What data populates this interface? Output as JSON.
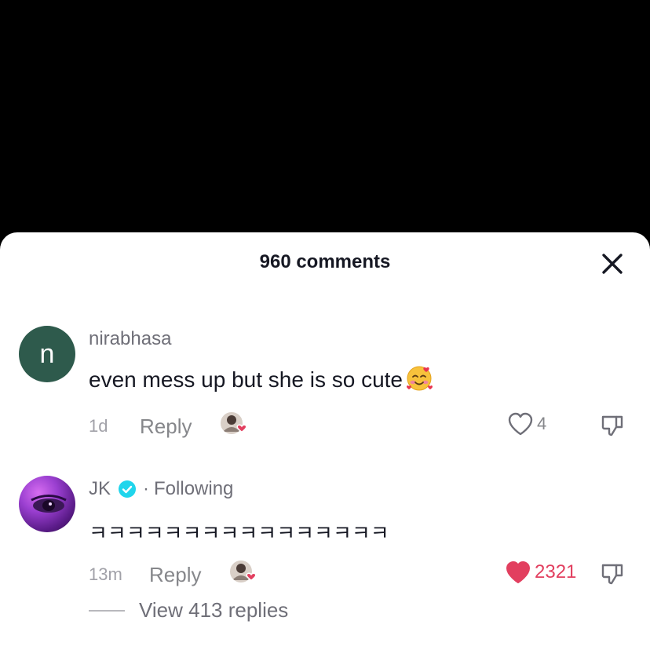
{
  "sheet": {
    "title": "960 comments"
  },
  "comments": [
    {
      "avatar_letter": "n",
      "username": "nirabhasa",
      "text": "even mess up but she is so cute",
      "emoji": "smiling-face-with-hearts",
      "time": "1d",
      "reply_label": "Reply",
      "likes": "4",
      "liked": false
    },
    {
      "username": "JK",
      "verified": true,
      "following_label": "Following",
      "separator": "·",
      "text": "ㅋㅋㅋㅋㅋㅋㅋㅋㅋㅋㅋㅋㅋㅋㅋㅋ",
      "time": "13m",
      "reply_label": "Reply",
      "likes": "2321",
      "liked": true,
      "view_replies_label": "View 413 replies"
    }
  ],
  "colors": {
    "like_active": "#e23f5f",
    "verified": "#20d5ec",
    "avatar_n": "#2e5a4c"
  }
}
